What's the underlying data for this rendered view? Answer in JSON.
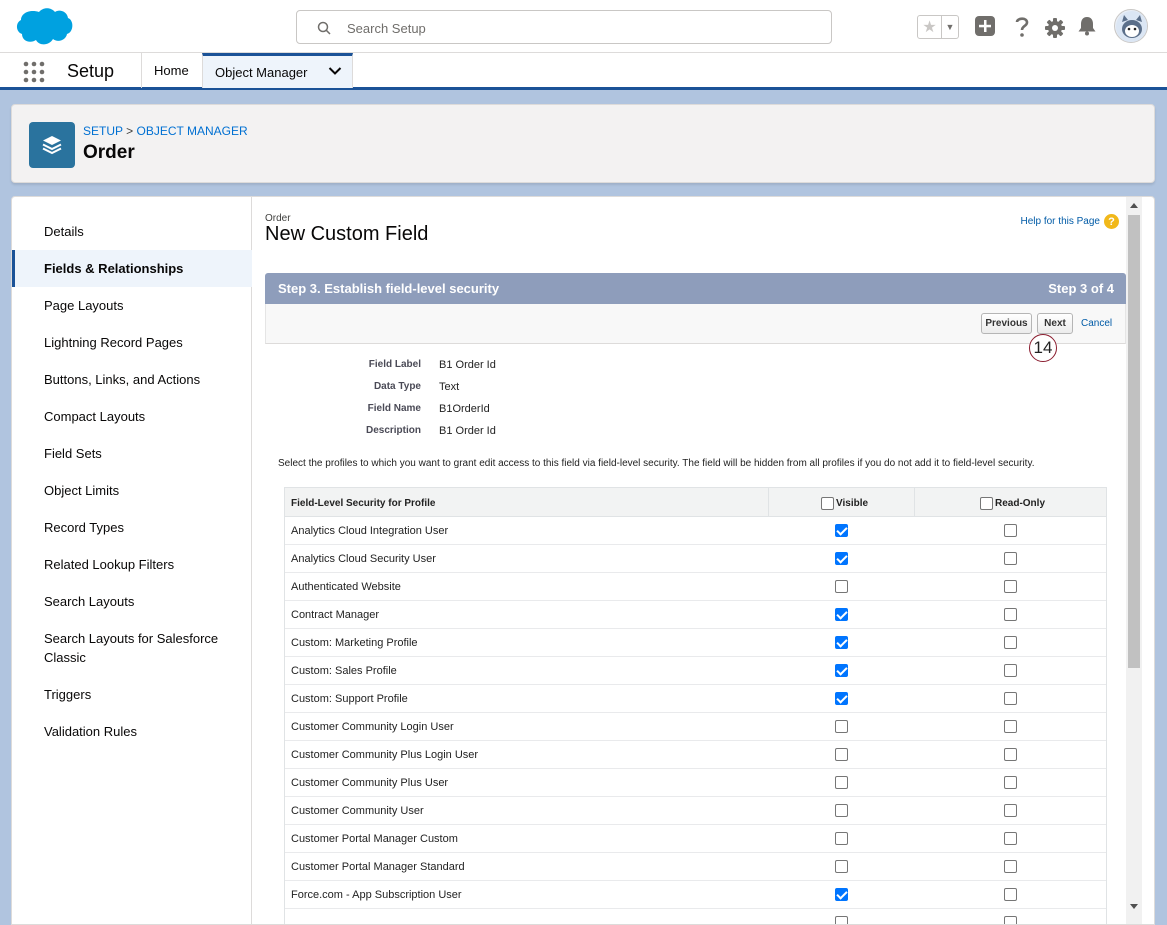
{
  "header": {
    "search_placeholder": "Search Setup"
  },
  "nav": {
    "app_name": "Setup",
    "tabs": [
      {
        "label": "Home"
      },
      {
        "label": "Object Manager"
      }
    ]
  },
  "object_header": {
    "breadcrumb_setup": "SETUP",
    "breadcrumb_sep": ">",
    "breadcrumb_object_manager": "OBJECT MANAGER",
    "title": "Order"
  },
  "sidebar": {
    "items": [
      {
        "label": "Details"
      },
      {
        "label": "Fields & Relationships"
      },
      {
        "label": "Page Layouts"
      },
      {
        "label": "Lightning Record Pages"
      },
      {
        "label": "Buttons, Links, and Actions"
      },
      {
        "label": "Compact Layouts"
      },
      {
        "label": "Field Sets"
      },
      {
        "label": "Object Limits"
      },
      {
        "label": "Record Types"
      },
      {
        "label": "Related Lookup Filters"
      },
      {
        "label": "Search Layouts"
      },
      {
        "label": "Search Layouts for Salesforce Classic"
      },
      {
        "label": "Triggers"
      },
      {
        "label": "Validation Rules"
      }
    ]
  },
  "page": {
    "object_name": "Order",
    "title": "New Custom Field",
    "help_link": "Help for this Page",
    "step_title": "Step 3. Establish field-level security",
    "step_count": "Step 3 of 4",
    "previous_label": "Previous",
    "next_label": "Next",
    "cancel_label": "Cancel",
    "callout_number": "14",
    "details": [
      {
        "key": "Field Label",
        "value": "B1 Order Id"
      },
      {
        "key": "Data Type",
        "value": "Text"
      },
      {
        "key": "Field Name",
        "value": "B1OrderId"
      },
      {
        "key": "Description",
        "value": "B1 Order Id"
      }
    ],
    "instructions": "Select the profiles to which you want to grant edit access to this field via field-level security. The field will be hidden from all profiles if you do not add it to field-level security."
  },
  "fls_table": {
    "col_profile": "Field-Level Security for Profile",
    "col_visible": "Visible",
    "col_readonly": "Read-Only",
    "rows": [
      {
        "profile": "Analytics Cloud Integration User",
        "visible": true,
        "readonly": false
      },
      {
        "profile": "Analytics Cloud Security User",
        "visible": true,
        "readonly": false
      },
      {
        "profile": "Authenticated Website",
        "visible": false,
        "readonly": false
      },
      {
        "profile": "Contract Manager",
        "visible": true,
        "readonly": false
      },
      {
        "profile": "Custom: Marketing Profile",
        "visible": true,
        "readonly": false
      },
      {
        "profile": "Custom: Sales Profile",
        "visible": true,
        "readonly": false
      },
      {
        "profile": "Custom: Support Profile",
        "visible": true,
        "readonly": false
      },
      {
        "profile": "Customer Community Login User",
        "visible": false,
        "readonly": false
      },
      {
        "profile": "Customer Community Plus Login User",
        "visible": false,
        "readonly": false
      },
      {
        "profile": "Customer Community Plus User",
        "visible": false,
        "readonly": false
      },
      {
        "profile": "Customer Community User",
        "visible": false,
        "readonly": false
      },
      {
        "profile": "Customer Portal Manager Custom",
        "visible": false,
        "readonly": false
      },
      {
        "profile": "Customer Portal Manager Standard",
        "visible": false,
        "readonly": false
      },
      {
        "profile": "Force.com - App Subscription User",
        "visible": true,
        "readonly": false
      },
      {
        "profile": "",
        "visible": false,
        "readonly": false
      }
    ]
  }
}
